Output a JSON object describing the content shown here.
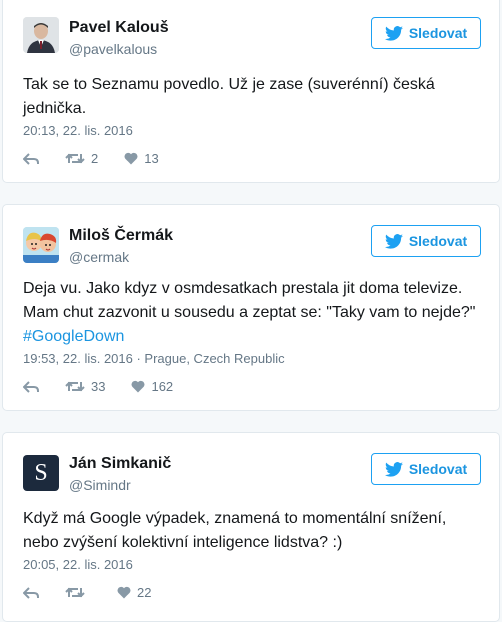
{
  "tweets": [
    {
      "name": "Pavel Kalouš",
      "handle": "@pavelkalous",
      "follow_label": "Sledovat",
      "text": "Tak se to Seznamu povedlo. Už je zase (suverénní) česká jednička.",
      "meta": "20:13, 22. lis. 2016",
      "retweets": "2",
      "likes": "13"
    },
    {
      "name": "Miloš Čermák",
      "handle": "@cermak",
      "follow_label": "Sledovat",
      "text": "Deja vu. Jako kdyz v osmdesatkach prestala jit doma televize. Mam chut zazvonit u sousedu a zeptat se: \"Taky vam to nejde?\"",
      "hashtag": "#GoogleDown",
      "meta": "19:53, 22. lis. 2016 · Prague, Czech Republic",
      "retweets": "33",
      "likes": "162"
    },
    {
      "name": "Ján Simkanič",
      "handle": "@Simindr",
      "avatar_letter": "S",
      "follow_label": "Sledovat",
      "text": "Když má Google výpadek, znamená to momentální snížení, nebo zvýšení kolektivní inteligence lidstva? :)",
      "meta": "20:05, 22. lis. 2016",
      "retweets": "",
      "likes": "22"
    }
  ],
  "colors": {
    "accent": "#1da1f2",
    "link": "#1b95e0",
    "muted": "#657786"
  }
}
